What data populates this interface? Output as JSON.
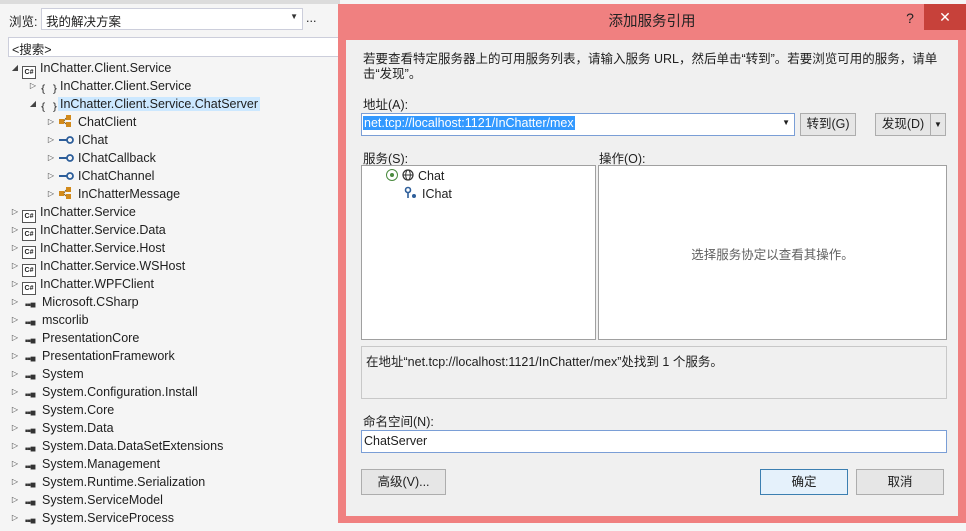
{
  "object_browser": {
    "browse_label": "浏览:",
    "browse_value": "我的解决方案",
    "browse_more": "...",
    "search_placeholder": "<搜索>",
    "tree": [
      {
        "label": "InChatter.Client.Service",
        "icon": "csharp-project-icon",
        "expander": "expanded",
        "level": 0
      },
      {
        "label": "InChatter.Client.Service",
        "icon": "namespace-icon",
        "expander": "collapsed",
        "level": 1
      },
      {
        "label": "InChatter.Client.Service.ChatServer",
        "icon": "namespace-icon",
        "expander": "expanded",
        "level": 1,
        "selected": true
      },
      {
        "label": "ChatClient",
        "icon": "class-icon",
        "expander": "collapsed",
        "level": 2
      },
      {
        "label": "IChat",
        "icon": "interface-icon",
        "expander": "collapsed",
        "level": 2
      },
      {
        "label": "IChatCallback",
        "icon": "interface-icon",
        "expander": "collapsed",
        "level": 2
      },
      {
        "label": "IChatChannel",
        "icon": "interface-icon",
        "expander": "collapsed",
        "level": 2
      },
      {
        "label": "InChatterMessage",
        "icon": "class-icon",
        "expander": "collapsed",
        "level": 2
      },
      {
        "label": "InChatter.Service",
        "icon": "csharp-project-icon",
        "expander": "collapsed",
        "level": 0
      },
      {
        "label": "InChatter.Service.Data",
        "icon": "csharp-project-icon",
        "expander": "collapsed",
        "level": 0
      },
      {
        "label": "InChatter.Service.Host",
        "icon": "csharp-project-icon",
        "expander": "collapsed",
        "level": 0
      },
      {
        "label": "InChatter.Service.WSHost",
        "icon": "csharp-project-icon",
        "expander": "collapsed",
        "level": 0
      },
      {
        "label": "InChatter.WPFClient",
        "icon": "csharp-project-icon",
        "expander": "collapsed",
        "level": 0
      },
      {
        "label": "Microsoft.CSharp",
        "icon": "reference-icon",
        "expander": "collapsed",
        "level": 0
      },
      {
        "label": "mscorlib",
        "icon": "reference-icon",
        "expander": "collapsed",
        "level": 0
      },
      {
        "label": "PresentationCore",
        "icon": "reference-icon",
        "expander": "collapsed",
        "level": 0
      },
      {
        "label": "PresentationFramework",
        "icon": "reference-icon",
        "expander": "collapsed",
        "level": 0
      },
      {
        "label": "System",
        "icon": "reference-icon",
        "expander": "collapsed",
        "level": 0
      },
      {
        "label": "System.Configuration.Install",
        "icon": "reference-icon",
        "expander": "collapsed",
        "level": 0
      },
      {
        "label": "System.Core",
        "icon": "reference-icon",
        "expander": "collapsed",
        "level": 0
      },
      {
        "label": "System.Data",
        "icon": "reference-icon",
        "expander": "collapsed",
        "level": 0
      },
      {
        "label": "System.Data.DataSetExtensions",
        "icon": "reference-icon",
        "expander": "collapsed",
        "level": 0
      },
      {
        "label": "System.Management",
        "icon": "reference-icon",
        "expander": "collapsed",
        "level": 0
      },
      {
        "label": "System.Runtime.Serialization",
        "icon": "reference-icon",
        "expander": "collapsed",
        "level": 0
      },
      {
        "label": "System.ServiceModel",
        "icon": "reference-icon",
        "expander": "collapsed",
        "level": 0
      },
      {
        "label": "System.ServiceProcess",
        "icon": "reference-icon",
        "expander": "collapsed",
        "level": 0
      }
    ]
  },
  "dialog": {
    "title": "添加服务引用",
    "help": "?",
    "close": "✕",
    "intro": "若要查看特定服务器上的可用服务列表，请输入服务 URL，然后单击“转到”。若要浏览可用的服务，请单击“发现”。",
    "address_label": "地址(A):",
    "address_value": "net.tcp://localhost:1121/InChatter/mex",
    "go_button": "转到(G)",
    "discover_button": "发现(D)",
    "services_label": "服务(S):",
    "operations_label": "操作(O):",
    "services": [
      {
        "label": "Chat",
        "icon": "service-icon"
      },
      {
        "label": "IChat",
        "icon": "contract-icon"
      }
    ],
    "operations_empty": "选择服务协定以查看其操作。",
    "status": "在地址“net.tcp://localhost:1121/InChatter/mex”处找到 1 个服务。",
    "namespace_label": "命名空间(N):",
    "namespace_value": "ChatServer",
    "advanced_button": "高级(V)...",
    "ok_button": "确定",
    "cancel_button": "取消",
    "colors": {
      "title_bar": "#f08080",
      "close_button": "#c7413a",
      "selection": "#3399ff"
    }
  }
}
